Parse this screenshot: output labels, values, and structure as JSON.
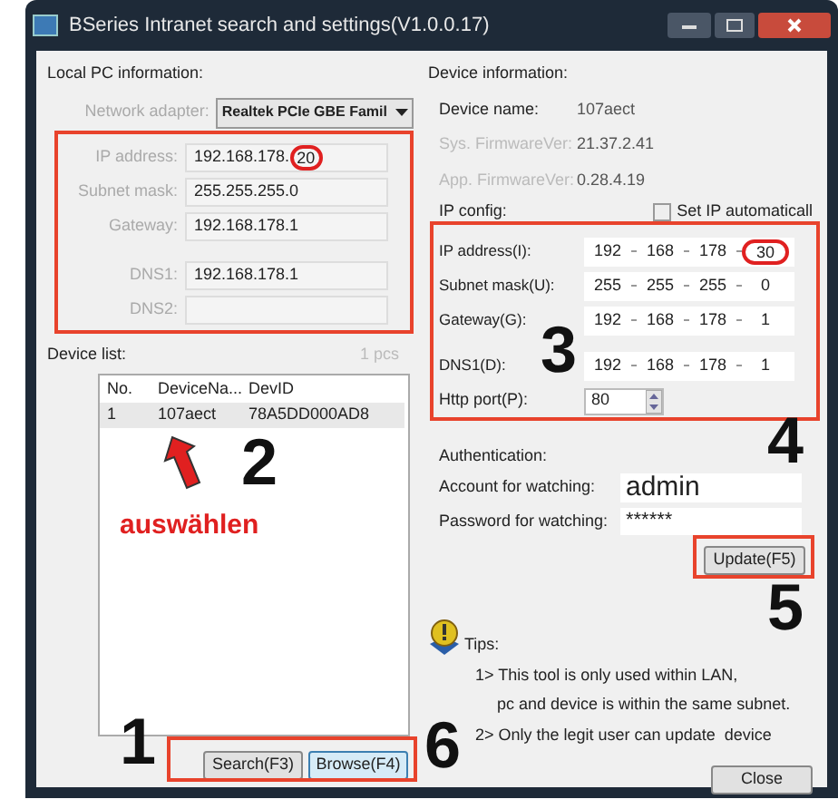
{
  "window": {
    "title": "BSeries Intranet search and settings(V1.0.0.17)"
  },
  "local_pc": {
    "heading": "Local PC information:",
    "adapter_label": "Network adapter:",
    "adapter_value": "Realtek PCIe GBE Famil",
    "fields": [
      {
        "label": "IP address:",
        "value": "192.168.178.",
        "circled_value": "20"
      },
      {
        "label": "Subnet mask:",
        "value": "255.255.255.0"
      },
      {
        "label": "Gateway:",
        "value": "192.168.178.1"
      },
      {
        "label": "DNS1:",
        "value": "192.168.178.1"
      },
      {
        "label": "DNS2:"
      }
    ]
  },
  "device_list": {
    "heading": "Device list:",
    "count": "1 pcs",
    "columns": [
      "No.",
      "DeviceNa...",
      "DevID"
    ],
    "rows": [
      {
        "cells": [
          "1",
          "107aect",
          "78A5DD000AD8"
        ],
        "selected": true
      }
    ]
  },
  "list_buttons": [
    {
      "label": "Search(F3)",
      "selected": false
    },
    {
      "label": "Browse(F4)",
      "selected": true
    }
  ],
  "device_info": {
    "heading": "Device information:",
    "fields": [
      {
        "label": "Device name:",
        "value": "107aect",
        "disabled": false
      },
      {
        "label": "Sys. FirmwareVer:",
        "value": "21.37.2.41",
        "disabled": true
      },
      {
        "label": "App. FirmwareVer:",
        "value": "0.28.4.19",
        "disabled": true
      }
    ],
    "ip_config": {
      "label": "IP config:",
      "checkbox_label": "Set IP automaticall",
      "checked": false
    },
    "ip_fields": [
      {
        "label": "IP address(I):",
        "octets": [
          "192",
          "168",
          "178",
          "30"
        ],
        "circled": true
      },
      {
        "label": "Subnet mask(U):",
        "octets": [
          "255",
          "255",
          "255",
          "0"
        ],
        "circled": false
      },
      {
        "label": "Gateway(G):",
        "octets": [
          "192",
          "168",
          "178",
          "1"
        ],
        "circled": false
      },
      {
        "label": "DNS1(D):",
        "octets": [
          "192",
          "168",
          "178",
          "1"
        ],
        "circled": false
      }
    ],
    "http_port": {
      "label": "Http port(P):",
      "value": "80"
    }
  },
  "authentication": {
    "heading": "Authentication:",
    "account_label": "Account for watching:",
    "account_value": "admin",
    "password_label": "Password for watching:",
    "password_value": "******"
  },
  "update_button": "Update(F5)",
  "tips": {
    "heading": "Tips:",
    "lines": [
      "1> This tool is only used within LAN,",
      "pc and device is within the same subnet.",
      "2> Only the legit user can update  device"
    ]
  },
  "close_button": "Close",
  "annotations": {
    "markers": [
      "1",
      "2",
      "3",
      "4",
      "5",
      "6"
    ],
    "caption": "auswählen"
  }
}
